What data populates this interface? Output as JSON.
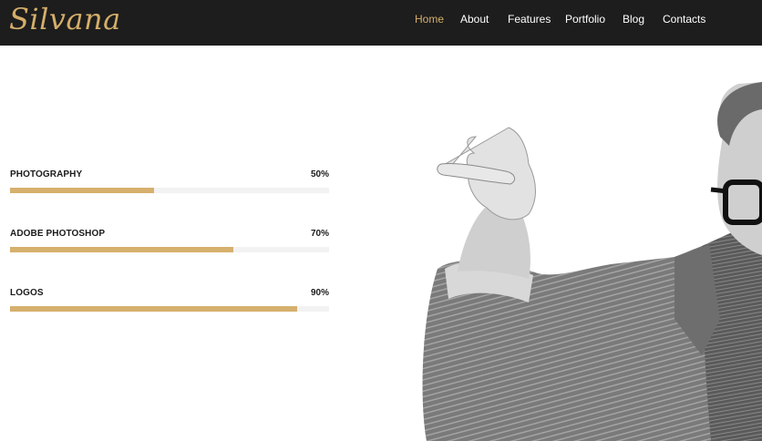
{
  "header": {
    "logo": "Silvana",
    "nav": [
      {
        "label": "Home",
        "active": true
      },
      {
        "label": "About",
        "active": false
      },
      {
        "label": "Features",
        "active": false
      },
      {
        "label": "Portfolio",
        "active": false
      },
      {
        "label": "Blog",
        "active": false
      },
      {
        "label": "Contacts",
        "active": false
      }
    ]
  },
  "skills": [
    {
      "label": "PHOTOGRAPHY",
      "value": "50%",
      "fraction": 0.45
    },
    {
      "label": "ADOBE PHOTOSHOP",
      "value": "70%",
      "fraction": 0.7
    },
    {
      "label": "LOGOS",
      "value": "90%",
      "fraction": 0.9
    }
  ],
  "colors": {
    "accent": "#d6b06d",
    "header_bg": "#1d1d1d",
    "track": "#f2f2f2"
  },
  "hero_image": {
    "icon": "man-pointing-photo"
  }
}
